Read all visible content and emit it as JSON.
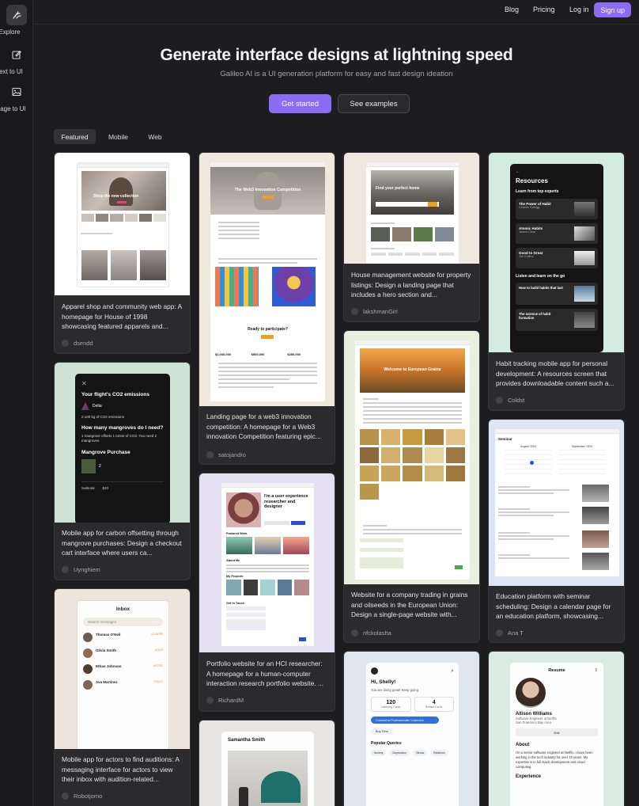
{
  "sidebar": {
    "items": [
      {
        "label": "Explore",
        "icon": "sparkle-icon"
      },
      {
        "label": "Text to UI",
        "icon": "edit-icon"
      },
      {
        "label": "Image to UI",
        "icon": "image-icon"
      }
    ]
  },
  "topnav": {
    "blog": "Blog",
    "pricing": "Pricing",
    "login": "Log in",
    "signup": "Sign up"
  },
  "hero": {
    "title": "Generate interface designs at lightning speed",
    "subtitle": "Galileo AI is a UI generation platform for easy and fast design ideation",
    "primary_cta": "Get started",
    "secondary_cta": "See examples"
  },
  "tabs": [
    "Featured",
    "Mobile",
    "Web"
  ],
  "cards": [
    {
      "desc": "Apparel shop and community web app: A homepage for House of 1998 showcasing featured apparels and...",
      "author": "dsendd",
      "thumb_text": "Shop the new collection"
    },
    {
      "desc": "Mobile app for carbon offsetting through mangrove purchases: Design a checkout cart interface where users ca...",
      "author": "Uynghiem",
      "thumb_texts": [
        "Your flight's CO2 emissions",
        "Delta",
        "2,100 kg of CO2 emissions",
        "How many mangroves do I need?",
        "1 mangrove offsets 1 tonne of CO2. You need 2 mangroves.",
        "Mangrove Purchase",
        "2",
        "Subtotal",
        "$40"
      ]
    },
    {
      "desc": "Mobile app for actors to find auditions: A messaging interface for actors to view their inbox with audition-related...",
      "author": "Robotjomo",
      "thumb_texts": [
        "Inbox",
        "Search messages",
        "Thomas O'Neil",
        "Olivia Smith",
        "Ethan Johnson",
        "Ava Martinez",
        "12:45 PM",
        "5/3/22",
        "6/17/22",
        "7/30/21"
      ]
    },
    {
      "desc": "Landing page for a web3 innovation competition: A homepage for a Web3 innovation Competition featuring epic...",
      "author": "satojandro",
      "thumb_texts": [
        "The Web3 Innovation Competition",
        "Ready to participate?",
        "$1,000,000",
        "$500,000",
        "$250,000"
      ]
    },
    {
      "desc": "Portfolio website for an HCI researcher: A homepage for a human-computer interaction research portfolio website. ...",
      "author": "RichardM",
      "thumb_texts": [
        "I'm a user experience researcher and designer",
        "Featured Work",
        "About Me",
        "My Projects",
        "Get in Touch"
      ]
    },
    {
      "desc": "",
      "author": "",
      "thumb_texts": [
        "Samantha Smith"
      ]
    },
    {
      "desc": "House management website for property listings: Design a landing page that includes a hero section and...",
      "author": "lakshmanGiri",
      "thumb_text": "Find your perfect home"
    },
    {
      "desc": "Website for a company trading in grains and oilseeds in the European Union: Design a single-page website with...",
      "author": "nfckolasha",
      "thumb_text": "Welcome to European Grains"
    },
    {
      "desc": "",
      "author": "",
      "thumb_texts": [
        "Hi, Shelly!",
        "You are doing great! Keep going.",
        "120",
        "Listening Cards",
        "4",
        "Breaks Cards",
        "Connect to Professionals / Listeners",
        "Buy Time",
        "Popular Queries",
        "Anxiety",
        "Depression",
        "Stress",
        "Relations"
      ]
    },
    {
      "desc": "Habit tracking mobile app for personal development: A resources screen that provides downloadable content such a...",
      "author": "Coldst",
      "thumb_texts": [
        "Resources",
        "Learn from top experts",
        "The Power of Habit",
        "Charles Duhigg",
        "Atomic Habits",
        "James Clear",
        "Good to Great",
        "Jim Collins",
        "Listen and learn on the go",
        "How to build habits that last",
        "The science of habit formation"
      ]
    },
    {
      "desc": "Education platform with seminar scheduling: Design a calendar page for an education platform, showcasing...",
      "author": "Ana T",
      "thumb_texts": [
        "Seminar",
        "August 2024",
        "September 2024"
      ]
    },
    {
      "desc": "",
      "author": "",
      "thumb_texts": [
        "Resume",
        "Allison Williams",
        "Software Engineer at Netflix",
        "San Francisco Bay Area",
        "Edit",
        "About",
        "I'm a senior software engineer at Netflix. I have been working in the tech industry for over 10 years. My expertise is in full stack development and cloud computing.",
        "Experience"
      ]
    }
  ]
}
